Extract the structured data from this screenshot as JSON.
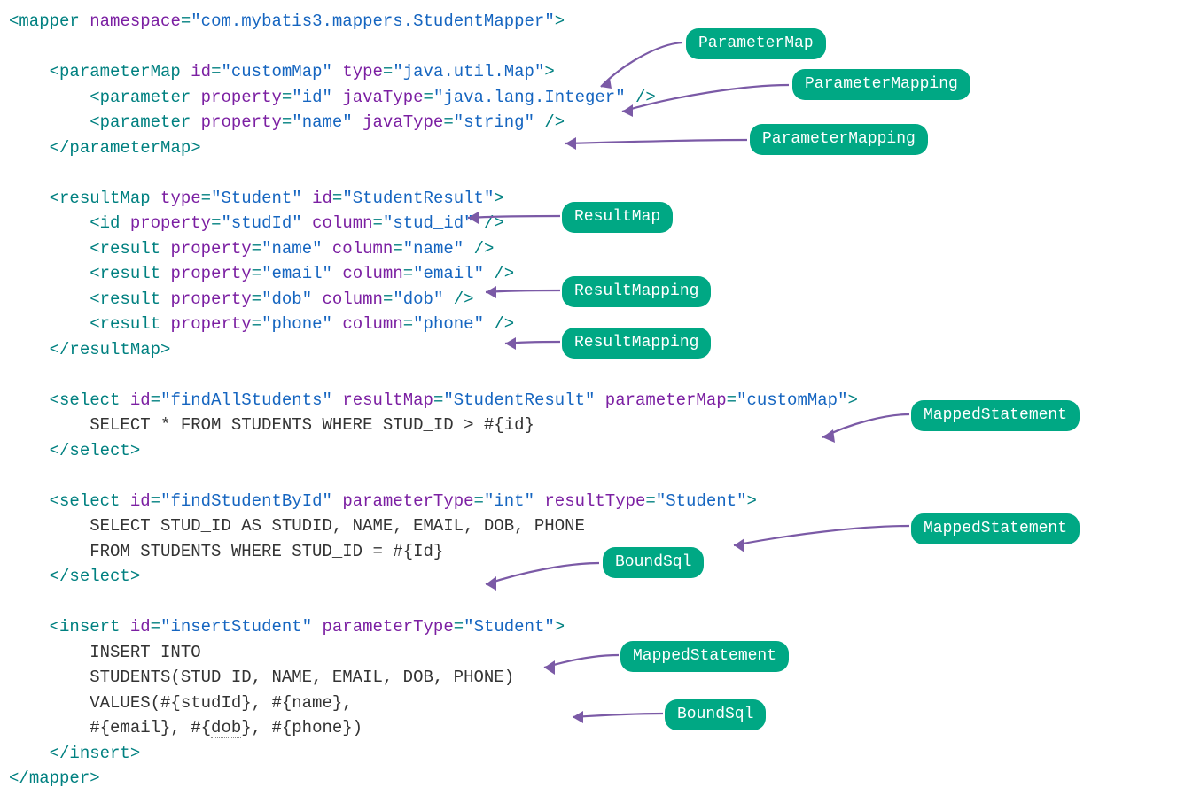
{
  "badges": {
    "parameterMap": "ParameterMap",
    "parameterMapping1": "ParameterMapping",
    "parameterMapping2": "ParameterMapping",
    "resultMap": "ResultMap",
    "resultMapping1": "ResultMapping",
    "resultMapping2": "ResultMapping",
    "mappedStatement1": "MappedStatement",
    "mappedStatement2": "MappedStatement",
    "mappedStatement3": "MappedStatement",
    "boundSql1": "BoundSql",
    "boundSql2": "BoundSql"
  },
  "xml": {
    "mapper": {
      "namespace": "com.mybatis3.mappers.StudentMapper"
    },
    "parameterMap": {
      "id": "customMap",
      "type": "java.util.Map",
      "params": [
        {
          "property": "id",
          "javaType": "java.lang.Integer"
        },
        {
          "property": "name",
          "javaType": "string"
        }
      ]
    },
    "resultMap": {
      "type": "Student",
      "id": "StudentResult",
      "idRow": {
        "property": "studId",
        "column": "stud_id"
      },
      "results": [
        {
          "property": "name",
          "column": "name"
        },
        {
          "property": "email",
          "column": "email"
        },
        {
          "property": "dob",
          "column": "dob"
        },
        {
          "property": "phone",
          "column": "phone"
        }
      ]
    },
    "select1": {
      "id": "findAllStudents",
      "resultMap": "StudentResult",
      "parameterMap": "customMap",
      "body": "SELECT * FROM STUDENTS WHERE STUD_ID > #{id}"
    },
    "select2": {
      "id": "findStudentById",
      "parameterType": "int",
      "resultType": "Student",
      "body1": "SELECT STUD_ID AS STUDID, NAME, EMAIL, DOB, PHONE",
      "body2": "FROM STUDENTS WHERE STUD_ID = #{Id}"
    },
    "insert": {
      "id": "insertStudent",
      "parameterType": "Student",
      "body1": "INSERT INTO",
      "body2": "STUDENTS(STUD_ID, NAME, EMAIL, DOB, PHONE)",
      "body3a": "VALUES(#{studId}, #{name},",
      "body3b_pre": "#{email}, #{",
      "body3b_dob": "dob",
      "body3b_post": "}, #{phone})"
    }
  }
}
